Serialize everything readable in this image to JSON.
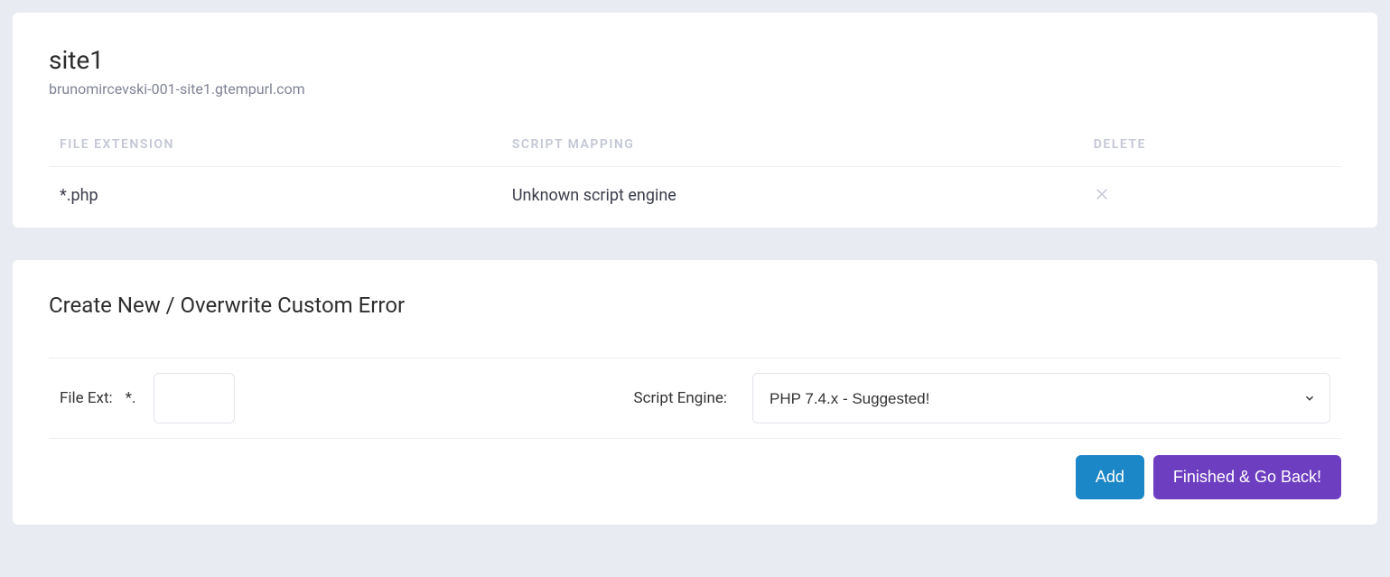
{
  "site": {
    "name": "site1",
    "url": "brunomircevski-001-site1.gtempurl.com"
  },
  "mapping_table": {
    "headers": {
      "ext": "FILE EXTENSION",
      "map": "SCRIPT MAPPING",
      "del": "DELETE"
    },
    "rows": [
      {
        "ext": "*.php",
        "mapping": "Unknown script engine"
      }
    ]
  },
  "form": {
    "title": "Create New / Overwrite Custom Error",
    "file_ext_label": "File Ext:",
    "file_ext_prefix": "*.",
    "file_ext_value": "",
    "engine_label": "Script Engine:",
    "engine_selected": "PHP 7.4.x - Suggested!"
  },
  "actions": {
    "add": "Add",
    "finish": "Finished & Go Back!"
  }
}
